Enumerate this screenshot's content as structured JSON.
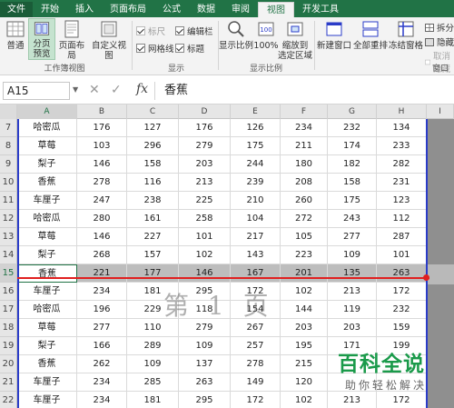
{
  "tabs": [
    "文件",
    "开始",
    "插入",
    "页面布局",
    "公式",
    "数据",
    "审阅",
    "视图",
    "开发工具"
  ],
  "active_tab": "视图",
  "ribbon": {
    "workbook_views": {
      "normal": "普通",
      "page_break_preview": [
        "分页",
        "预览"
      ],
      "page_layout": "页面布局",
      "custom_views": "自定义视图",
      "group_label": "工作簿视图"
    },
    "show": {
      "ruler": "标尺",
      "formula_bar": "编辑栏",
      "gridlines": "网格线",
      "headings": "标题",
      "group_label": "显示"
    },
    "zoom": {
      "zoom": "显示比例",
      "hundred": "100%",
      "zoom_to_selection": [
        "缩放到",
        "选定区域"
      ],
      "group_label": "显示比例"
    },
    "window": {
      "new_window": "新建窗口",
      "arrange_all": "全部重排",
      "freeze_panes": "冻结窗格",
      "split": "拆分",
      "hide": "隐藏",
      "unhide": "取消隐藏",
      "group_label": "窗口"
    }
  },
  "formula_bar": {
    "name_box": "A15",
    "fx": "fx",
    "value": "香蕉"
  },
  "columns": [
    "A",
    "B",
    "C",
    "D",
    "E",
    "F",
    "G",
    "H",
    "I"
  ],
  "rows": [
    {
      "num": "7",
      "name": "哈密瓜",
      "values": [
        "176",
        "127",
        "176",
        "126",
        "234",
        "232",
        "134"
      ]
    },
    {
      "num": "8",
      "name": "草莓",
      "values": [
        "103",
        "296",
        "279",
        "175",
        "211",
        "174",
        "233"
      ]
    },
    {
      "num": "9",
      "name": "梨子",
      "values": [
        "146",
        "158",
        "203",
        "244",
        "180",
        "182",
        "282"
      ]
    },
    {
      "num": "10",
      "name": "香蕉",
      "values": [
        "278",
        "116",
        "213",
        "239",
        "208",
        "158",
        "231"
      ]
    },
    {
      "num": "11",
      "name": "车厘子",
      "values": [
        "247",
        "238",
        "225",
        "210",
        "260",
        "175",
        "123"
      ]
    },
    {
      "num": "12",
      "name": "哈密瓜",
      "values": [
        "280",
        "161",
        "258",
        "104",
        "272",
        "243",
        "112"
      ]
    },
    {
      "num": "13",
      "name": "草莓",
      "values": [
        "146",
        "227",
        "101",
        "217",
        "105",
        "277",
        "287"
      ]
    },
    {
      "num": "14",
      "name": "梨子",
      "values": [
        "268",
        "157",
        "102",
        "143",
        "223",
        "109",
        "101"
      ]
    },
    {
      "num": "15",
      "name": "香蕉",
      "values": [
        "221",
        "177",
        "146",
        "167",
        "201",
        "135",
        "263"
      ]
    },
    {
      "num": "16",
      "name": "车厘子",
      "values": [
        "234",
        "181",
        "295",
        "172",
        "102",
        "213",
        "172"
      ]
    },
    {
      "num": "17",
      "name": "哈密瓜",
      "values": [
        "196",
        "229",
        "118",
        "154",
        "144",
        "119",
        "232"
      ]
    },
    {
      "num": "18",
      "name": "草莓",
      "values": [
        "277",
        "110",
        "279",
        "267",
        "203",
        "203",
        "159"
      ]
    },
    {
      "num": "19",
      "name": "梨子",
      "values": [
        "166",
        "289",
        "109",
        "257",
        "195",
        "171",
        "199"
      ]
    },
    {
      "num": "20",
      "name": "香蕉",
      "values": [
        "262",
        "109",
        "137",
        "278",
        "215",
        "",
        ""
      ]
    },
    {
      "num": "21",
      "name": "车厘子",
      "values": [
        "234",
        "285",
        "263",
        "149",
        "120",
        "",
        ""
      ]
    },
    {
      "num": "22",
      "name": "车厘子",
      "values": [
        "234",
        "181",
        "295",
        "172",
        "102",
        "213",
        "172"
      ]
    }
  ],
  "selected_row": "15",
  "page_watermark": "第 1 页",
  "logo": {
    "title": "百科全说",
    "subtitle": "助你轻松解决"
  },
  "colors": {
    "excel_green": "#217346",
    "page_break_blue": "#2b3cc8",
    "red_line": "#e02020"
  }
}
